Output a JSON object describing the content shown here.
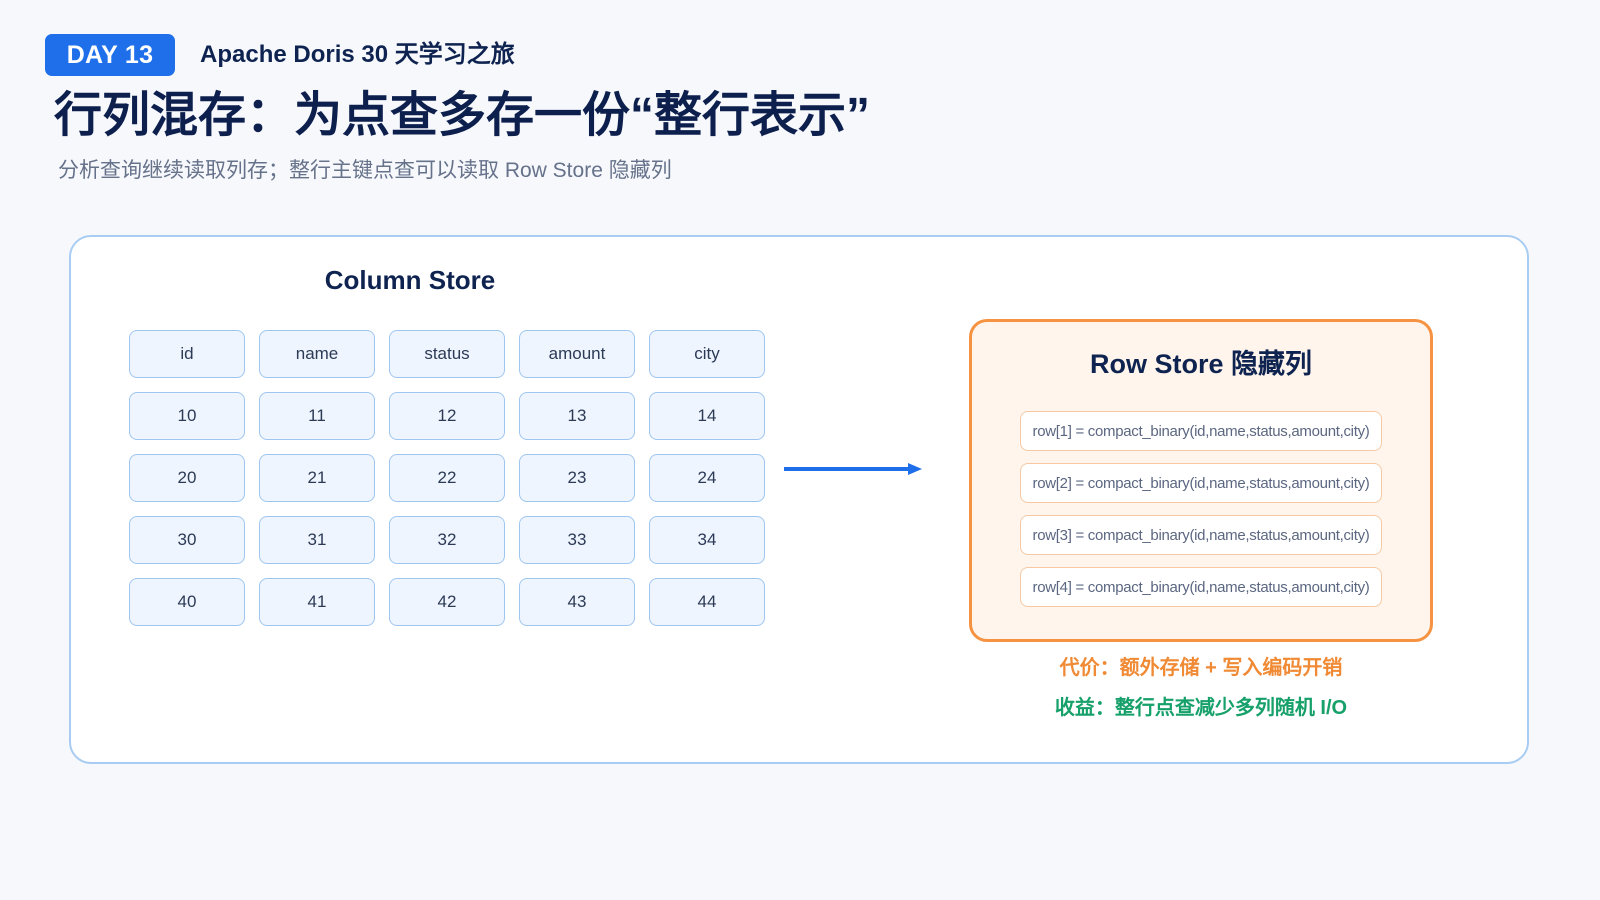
{
  "header": {
    "badge": "DAY 13",
    "series_title": "Apache Doris 30 天学习之旅",
    "title": "行列混存：为点查多存一份“整行表示”",
    "subtitle": "分析查询继续读取列存；整行主键点查可以读取 Row Store 隐藏列"
  },
  "column_store": {
    "title": "Column Store",
    "headers": [
      "id",
      "name",
      "status",
      "amount",
      "city"
    ],
    "rows": [
      [
        "10",
        "11",
        "12",
        "13",
        "14"
      ],
      [
        "20",
        "21",
        "22",
        "23",
        "24"
      ],
      [
        "30",
        "31",
        "32",
        "33",
        "34"
      ],
      [
        "40",
        "41",
        "42",
        "43",
        "44"
      ]
    ]
  },
  "row_store": {
    "title": "Row Store 隐藏列",
    "rows": [
      "row[1] = compact_binary(id,name,status,amount,city)",
      "row[2] = compact_binary(id,name,status,amount,city)",
      "row[3] = compact_binary(id,name,status,amount,city)",
      "row[4] = compact_binary(id,name,status,amount,city)"
    ]
  },
  "notes": {
    "cost": "代价：额外存储 + 写入编码开销",
    "benefit": "收益：整行点查减少多列随机 I/O"
  },
  "colors": {
    "accent_blue": "#1f6fea",
    "title_navy": "#0c1f4d",
    "cell_border": "#9fc6ef",
    "row_store_border": "#f59342",
    "cost_orange": "#f08a34",
    "benefit_green": "#16a06a"
  }
}
